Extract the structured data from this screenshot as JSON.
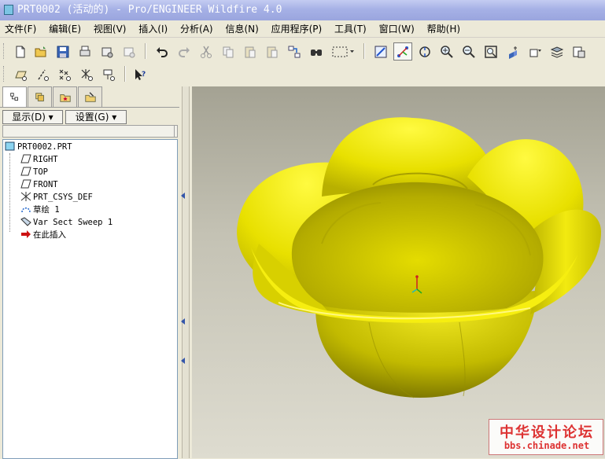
{
  "window": {
    "title": "PRT0002 (活动的) - Pro/ENGINEER Wildfire 4.0"
  },
  "menu": [
    "文件(F)",
    "编辑(E)",
    "视图(V)",
    "插入(I)",
    "分析(A)",
    "信息(N)",
    "应用程序(P)",
    "工具(T)",
    "窗口(W)",
    "帮助(H)"
  ],
  "panel": {
    "show_label": "显示(D) ▾",
    "settings_label": "设置(G) ▾"
  },
  "tree": {
    "root": "PRT0002.PRT",
    "items": [
      "RIGHT",
      "TOP",
      "FRONT",
      "PRT_CSYS_DEF",
      "草绘 1",
      "Var Sect Sweep 1",
      "在此插入"
    ]
  },
  "colors": {
    "model": "#e6e000",
    "model_shade": "#8c8600",
    "accent": "#3355aa"
  },
  "watermark": {
    "line1": "中华设计论坛",
    "line2": "bbs.chinade.net"
  }
}
